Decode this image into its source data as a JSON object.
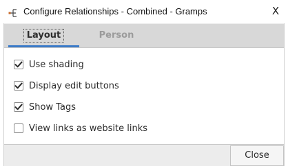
{
  "window": {
    "title": "Configure Relationships - Combined - Gramps",
    "close_glyph": "X",
    "app_icon": "gramps-tree-icon"
  },
  "tabs": [
    {
      "label": "Layout",
      "active": true
    },
    {
      "label": "Person",
      "active": false
    }
  ],
  "options": [
    {
      "label": "Use shading",
      "checked": true
    },
    {
      "label": "Display edit buttons",
      "checked": true
    },
    {
      "label": "Show Tags",
      "checked": true
    },
    {
      "label": "View links as website links",
      "checked": false
    }
  ],
  "footer": {
    "close_label": "Close"
  },
  "colors": {
    "accent": "#3a7ac8",
    "tab_bar": "#d8d8d8",
    "inactive_tab_text": "#9b9b9b"
  }
}
